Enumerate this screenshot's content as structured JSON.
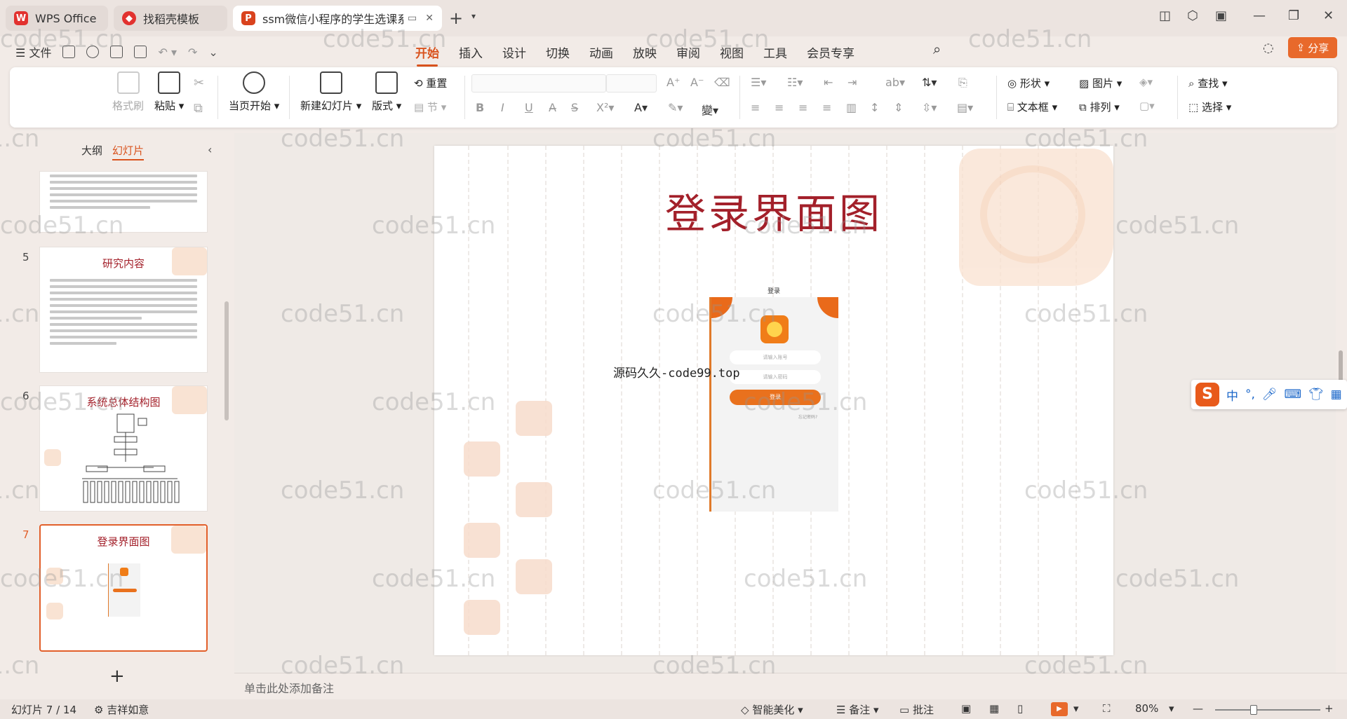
{
  "tabs": [
    {
      "label": "WPS Office",
      "icon": "wps-logo-icon"
    },
    {
      "label": "找稻壳模板",
      "icon": "daoke-logo-icon"
    },
    {
      "label": "ssm微信小程序的学生选课系统",
      "icon": "ppt-file-icon"
    }
  ],
  "menu": {
    "file": "文件",
    "tabs": [
      "开始",
      "插入",
      "设计",
      "切换",
      "动画",
      "放映",
      "审阅",
      "视图",
      "工具",
      "会员专享"
    ],
    "active_tab": "开始",
    "share": "分享"
  },
  "ribbon": {
    "format_painter": "格式刷",
    "paste": "粘贴",
    "play_from_current": "当页开始",
    "new_slide": "新建幻灯片",
    "layout": "版式",
    "reset": "重置",
    "section": "节",
    "shape": "形状",
    "picture": "图片",
    "textbox": "文本框",
    "arrange": "排列",
    "find": "查找",
    "select": "选择"
  },
  "left_panel": {
    "tab_outline": "大纲",
    "tab_slides": "幻灯片",
    "slides": [
      {
        "number": "5",
        "title": "研究内容"
      },
      {
        "number": "6",
        "title": "系统总体结构图"
      },
      {
        "number": "7",
        "title": "登录界面图",
        "selected": true
      }
    ]
  },
  "slide": {
    "title": "登录界面图",
    "watermark_text": "源码久久-code99.top",
    "phone": {
      "title": "登录",
      "username_placeholder": "请输入账号",
      "password_placeholder": "请输入密码",
      "login_button": "登录",
      "forgot": "忘记密码?"
    }
  },
  "notes_placeholder": "单击此处添加备注",
  "status": {
    "slide_counter": "幻灯片 7 / 14",
    "theme": "吉祥如意",
    "smart_beautify": "智能美化",
    "notes": "备注",
    "comments": "批注",
    "zoom": "80%"
  },
  "ime": {
    "lang": "中",
    "punct": "°,"
  },
  "watermark": "code51.cn",
  "colors": {
    "accent": "#d9531e",
    "title_red": "#a3202a",
    "share_bg": "#e8692b"
  }
}
